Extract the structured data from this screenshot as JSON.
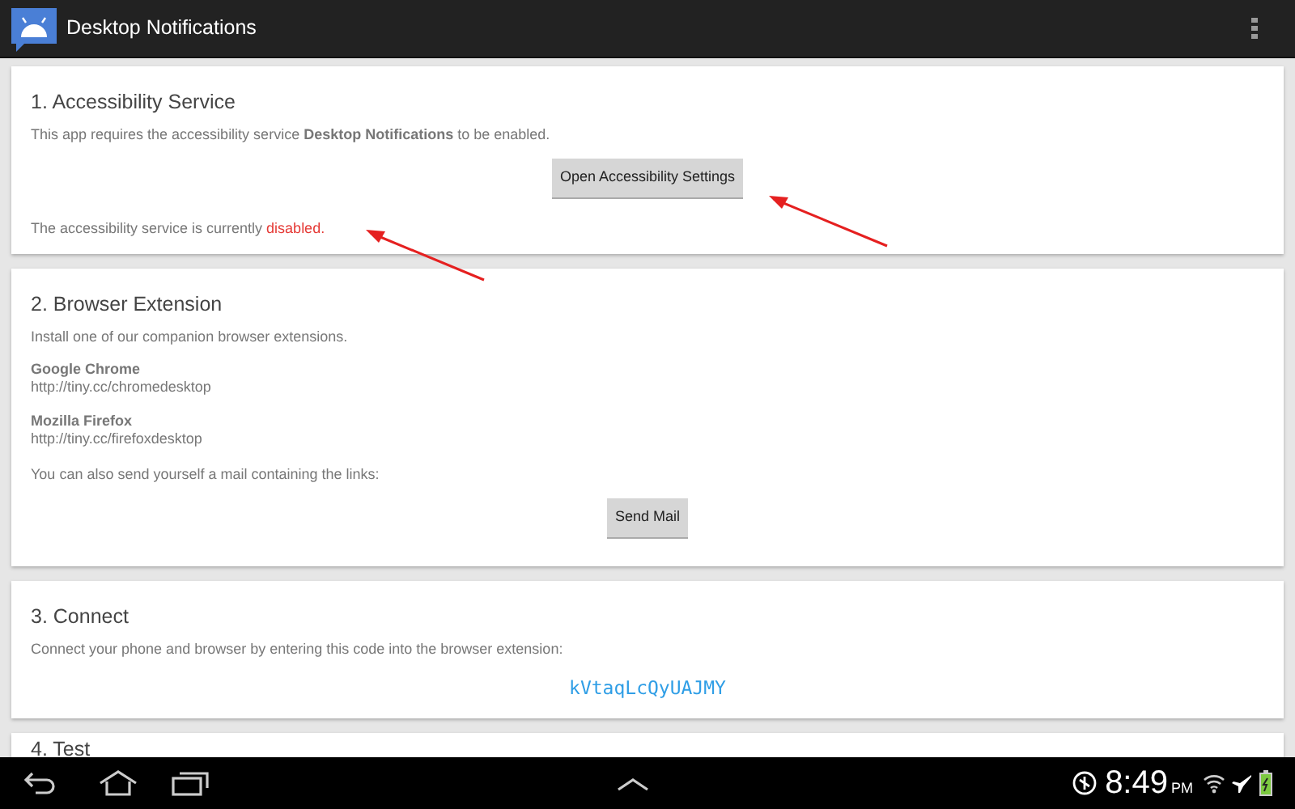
{
  "app_bar": {
    "title": "Desktop Notifications"
  },
  "sections": [
    {
      "title": "1. Accessibility Service",
      "items": [
        {
          "kind": "text",
          "text": "This app requires the accessibility service **Desktop Notifications** to be enabled."
        },
        {
          "kind": "button",
          "label": "Open Accessibility Settings"
        },
        {
          "kind": "status",
          "text": "The accessibility service is currently",
          "value": "disabled.",
          "enabled": false
        }
      ]
    },
    {
      "title": "2. Browser Extension",
      "items": [
        {
          "kind": "text",
          "text": "Install one of our companion browser extensions."
        },
        {
          "kind": "link",
          "name": "Google Chrome",
          "url": "http://tiny.cc/chromedesktop"
        },
        {
          "kind": "link",
          "name": "Mozilla Firefox",
          "url": "http://tiny.cc/firefoxdesktop"
        },
        {
          "kind": "text",
          "text": "You can also send yourself a mail containing the links:"
        },
        {
          "kind": "button",
          "label": "Send Mail"
        }
      ]
    },
    {
      "title": "3. Connect",
      "items": [
        {
          "kind": "text",
          "text": "Connect your phone and browser by entering this code into the browser extension:"
        },
        {
          "kind": "code",
          "text": "kVtaqLcQyUAJMY"
        }
      ]
    },
    {
      "title": "4. Test"
    }
  ],
  "nav_bar": {
    "time": "8:49",
    "period": "PM"
  }
}
